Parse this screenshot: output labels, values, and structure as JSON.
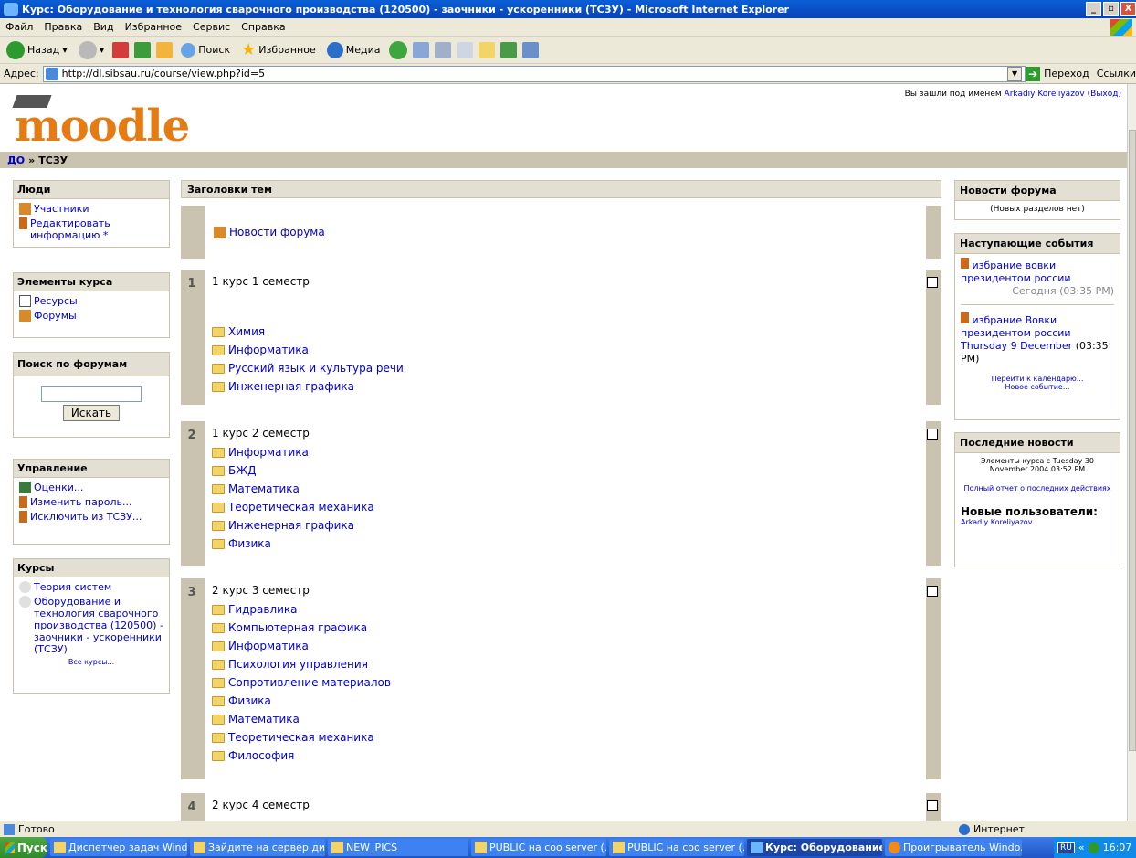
{
  "window": {
    "title": "Курс: Оборудование и технология сварочного производства (120500) - заочники - ускоренники (ТСЗУ) - Microsoft Internet Explorer",
    "controls": [
      "_",
      "▫",
      "X"
    ]
  },
  "menu": [
    "Файл",
    "Правка",
    "Вид",
    "Избранное",
    "Сервис",
    "Справка"
  ],
  "toolbar": {
    "back": "Назад",
    "search": "Поиск",
    "favorites": "Избранное",
    "media": "Медиа"
  },
  "address": {
    "label": "Адрес:",
    "url": "http://dl.sibsau.ru/course/view.php?id=5",
    "go": "Переход",
    "links": "Ссылки"
  },
  "header": {
    "logo": "moodle",
    "login_prefix": "Вы зашли под именем",
    "user": "Arkadiy Koreliyazov",
    "logout": "(Выход)"
  },
  "breadcrumb": {
    "home": "ДО",
    "sep": "»",
    "current": "ТСЗУ"
  },
  "left": {
    "people": {
      "title": "Люди",
      "items": [
        "Участники",
        "Редактировать информацию *"
      ]
    },
    "activities": {
      "title": "Элементы курса",
      "items": [
        "Ресурсы",
        "Форумы"
      ]
    },
    "search": {
      "title": "Поиск по форумам",
      "button": "Искать"
    },
    "admin": {
      "title": "Управление",
      "items": [
        "Оценки...",
        "Изменить пароль...",
        "Исключить из ТСЗУ..."
      ]
    },
    "courses": {
      "title": "Курсы",
      "items": [
        "Теория систем",
        "Оборудование и технология сварочного производства (120500) - заочники - ускоренники (ТСЗУ)"
      ],
      "all": "Все курсы..."
    }
  },
  "main": {
    "title": "Заголовки тем",
    "news": "Новости форума",
    "topics": [
      {
        "num": "1",
        "title": "1 курс 1 семестр",
        "items": [
          "Химия",
          "Информатика",
          "Русский язык и культура речи",
          "Инженерная графика"
        ]
      },
      {
        "num": "2",
        "title": "1 курс 2 семестр",
        "items": [
          "Информатика",
          "БЖД",
          "Математика",
          "Теоретическая механика",
          "Инженерная графика",
          "Физика"
        ]
      },
      {
        "num": "3",
        "title": "2 курс 3 семестр",
        "items": [
          "Гидравлика",
          "Компьютерная графика",
          "Информатика",
          "Психология управления",
          "Сопротивление материалов",
          "Физика",
          "Математика",
          "Теоретическая механика",
          "Философия"
        ]
      },
      {
        "num": "4",
        "title": "2 курс 4 семестр",
        "items": []
      }
    ]
  },
  "right": {
    "forum_news": {
      "title": "Новости форума",
      "empty": "(Новых разделов нет)"
    },
    "events": {
      "title": "Наступающие события",
      "items": [
        {
          "name": "избрание вовки президентом россии",
          "date": "Сегодня (03:35 PM)"
        },
        {
          "name": "избрание Вовки президентом россии",
          "date_a": "Thursday 9 December",
          "date_b": "(03:35 PM)"
        }
      ],
      "calendar": "Перейти к календарю...",
      "new_event": "Новое событие..."
    },
    "recent": {
      "title": "Последние новости",
      "since": "Элементы курса с Tuesday 30 November 2004 03:52 PM",
      "full": "Полный отчет о последних действиях",
      "new_users_title": "Новые пользователи:",
      "new_user": "Arkadiy Koreliyazov"
    }
  },
  "status": {
    "text": "Готово",
    "zone": "Интернет"
  },
  "taskbar": {
    "start": "Пуск",
    "tasks": [
      "Диспетчер задач Wind...",
      "Зайдите на сервер ди...",
      "NEW_PICS",
      "PUBLIC на coo server (...",
      "PUBLIC на coo server (...",
      "Курс: Оборудование...",
      "Проигрыватель Windo..."
    ],
    "lang": "RU",
    "time": "16:07"
  }
}
